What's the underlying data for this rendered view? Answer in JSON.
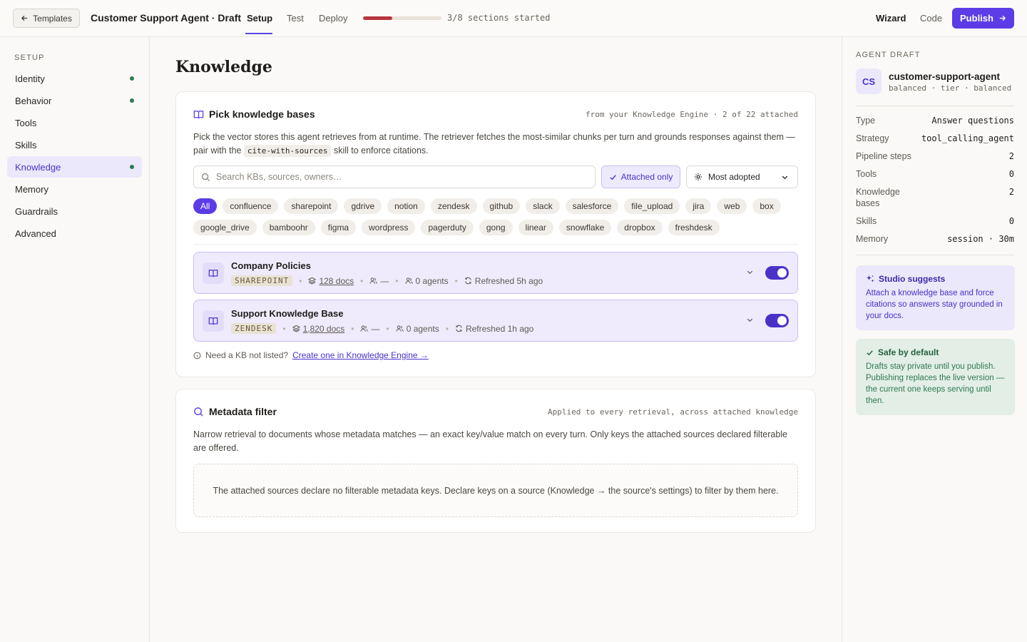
{
  "topbar": {
    "back_label": "Templates",
    "title": "Customer Support Agent · Draft",
    "tabs": [
      {
        "label": "Setup",
        "active": true
      },
      {
        "label": "Test"
      },
      {
        "label": "Deploy"
      }
    ],
    "progress": {
      "started": 3,
      "total": 8,
      "fraction": 0.375,
      "label": "3/8 sections started",
      "color": "#b8353e"
    },
    "wizard_label": "Wizard",
    "code_label": "Code",
    "publish_label": "Publish"
  },
  "sidebar": {
    "heading": "SETUP",
    "items": [
      {
        "label": "Identity",
        "done": true
      },
      {
        "label": "Behavior",
        "done": true
      },
      {
        "label": "Tools",
        "done": false
      },
      {
        "label": "Skills",
        "done": false
      },
      {
        "label": "Knowledge",
        "done": true,
        "active": true
      },
      {
        "label": "Memory",
        "done": false
      },
      {
        "label": "Guardrails",
        "done": false
      },
      {
        "label": "Advanced",
        "done": false
      }
    ]
  },
  "main": {
    "page_title": "Knowledge",
    "kb_card": {
      "title": "Pick knowledge bases",
      "meta": "from your Knowledge Engine · 2 of 22 attached",
      "desc_before": "Pick the vector stores this agent retrieves from at runtime. The retriever fetches the most-similar chunks per turn and grounds responses against them — pair with the ",
      "desc_code": "cite-with-sources",
      "desc_after": " skill to enforce citations.",
      "search_placeholder": "Search KBs, sources, owners…",
      "attached_only_label": "Attached only",
      "sort_label": "Most adopted",
      "chips": [
        "All",
        "confluence",
        "sharepoint",
        "gdrive",
        "notion",
        "zendesk",
        "github",
        "slack",
        "salesforce",
        "file_upload",
        "jira",
        "web",
        "box",
        "google_drive",
        "bamboohr",
        "figma",
        "wordpress",
        "pagerduty",
        "gong",
        "linear",
        "snowflake",
        "dropbox",
        "freshdesk"
      ],
      "active_chip": "All",
      "kbs": [
        {
          "name": "Company Policies",
          "source": "SHAREPOINT",
          "docs": "128 docs",
          "owner": "—",
          "agents": "0 agents",
          "refreshed": "Refreshed 5h ago",
          "enabled": true
        },
        {
          "name": "Support Knowledge Base",
          "source": "ZENDESK",
          "docs": "1,820 docs",
          "owner": "—",
          "agents": "0 agents",
          "refreshed": "Refreshed 1h ago",
          "enabled": true
        }
      ],
      "footer_text": "Need a KB not listed?",
      "footer_link": "Create one in Knowledge Engine →"
    },
    "meta_card": {
      "title": "Metadata filter",
      "meta": "Applied to every retrieval, across attached knowledge",
      "desc": "Narrow retrieval to documents whose metadata matches — an exact key/value match on every turn. Only keys the attached sources declared filterable are offered.",
      "empty": "The attached sources declare no filterable metadata keys. Declare keys on a source (Knowledge → the source's settings) to filter by them here."
    }
  },
  "right_panel": {
    "heading": "AGENT DRAFT",
    "avatar": "CS",
    "agent_name": "customer-support-agent",
    "agent_sub": "balanced · tier · balanced",
    "stats": [
      {
        "label": "Type",
        "value": "Answer questions"
      },
      {
        "label": "Strategy",
        "value": "tool_calling_agent"
      },
      {
        "label": "Pipeline steps",
        "value": "2"
      },
      {
        "label": "Tools",
        "value": "0"
      },
      {
        "label": "Knowledge bases",
        "value": "2"
      },
      {
        "label": "Skills",
        "value": "0"
      },
      {
        "label": "Memory",
        "value": "session · 30m"
      }
    ],
    "suggest": {
      "title": "Studio suggests",
      "body": "Attach a knowledge base and force citations so answers stay grounded in your docs."
    },
    "safe": {
      "title": "Safe by default",
      "body": "Drafts stay private until you publish. Publishing replaces the live version — the current one keeps serving until then."
    }
  },
  "colors": {
    "accent": "#5b3ce6",
    "accent_soft": "#ece8fb",
    "success": "#2f7a52",
    "progress": "#b8353e"
  }
}
